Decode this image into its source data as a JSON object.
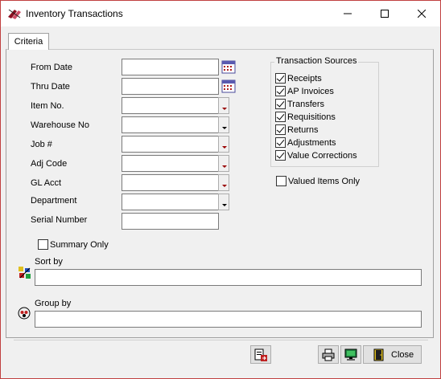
{
  "window": {
    "title": "Inventory Transactions"
  },
  "tabs": {
    "criteria": "Criteria"
  },
  "fields": {
    "from_date": {
      "label": "From Date",
      "value": ""
    },
    "thru_date": {
      "label": "Thru Date",
      "value": ""
    },
    "item_no": {
      "label": "Item No.",
      "value": ""
    },
    "warehouse_no": {
      "label": "Warehouse No",
      "value": ""
    },
    "job": {
      "label": "Job #",
      "value": ""
    },
    "adj_code": {
      "label": "Adj Code",
      "value": ""
    },
    "gl_acct": {
      "label": "GL Acct",
      "value": ""
    },
    "department": {
      "label": "Department",
      "value": ""
    },
    "serial_number": {
      "label": "Serial Number",
      "value": ""
    }
  },
  "transaction_sources": {
    "title": "Transaction Sources",
    "items": [
      {
        "label": "Receipts",
        "checked": true
      },
      {
        "label": "AP Invoices",
        "checked": true
      },
      {
        "label": "Transfers",
        "checked": true
      },
      {
        "label": "Requisitions",
        "checked": true
      },
      {
        "label": "Returns",
        "checked": true
      },
      {
        "label": "Adjustments",
        "checked": true
      },
      {
        "label": "Value Corrections",
        "checked": true
      }
    ]
  },
  "options": {
    "valued_items_only": {
      "label": "Valued Items Only",
      "checked": false
    },
    "summary_only": {
      "label": "Summary Only",
      "checked": false
    }
  },
  "sort_by": {
    "label": "Sort by",
    "value": ""
  },
  "group_by": {
    "label": "Group by",
    "value": ""
  },
  "buttons": {
    "close": "Close"
  },
  "icons": {
    "app": "inventory-app-icon",
    "calendar": "calendar-icon",
    "sort": "sort-icon",
    "group": "group-icon",
    "export": "export-icon",
    "print": "printer-icon",
    "preview": "monitor-icon",
    "close": "door-exit-icon"
  }
}
